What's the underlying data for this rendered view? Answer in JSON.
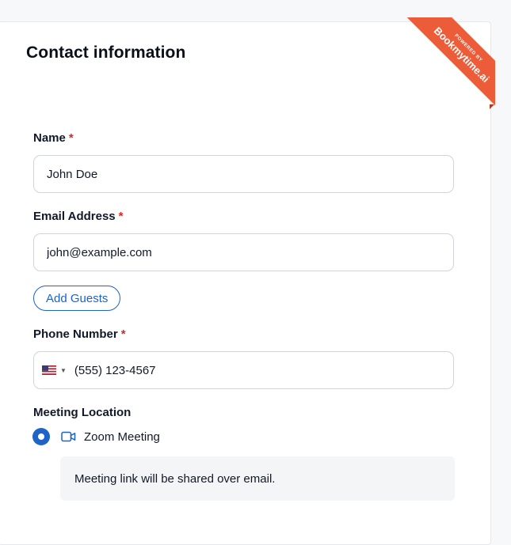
{
  "form": {
    "title": "Contact information",
    "name": {
      "label": "Name",
      "required_mark": "*",
      "value": "John Doe"
    },
    "email": {
      "label": "Email Address",
      "required_mark": "*",
      "value": "john@example.com"
    },
    "add_guests_label": "Add Guests",
    "phone": {
      "label": "Phone Number",
      "required_mark": "*",
      "country_flag": "us-flag-icon",
      "value": "(555) 123-4567"
    },
    "meeting_location": {
      "label": "Meeting Location",
      "options": [
        {
          "label": "Zoom Meeting",
          "selected": true,
          "icon": "video-camera-icon"
        }
      ],
      "note": "Meeting link will be shared over email."
    }
  },
  "ribbon": {
    "small_text": "POWERED BY",
    "brand": "Bookmytime.ai",
    "color": "#ec5c38"
  },
  "colors": {
    "accent": "#1d63c8",
    "required": "#dc2626"
  }
}
